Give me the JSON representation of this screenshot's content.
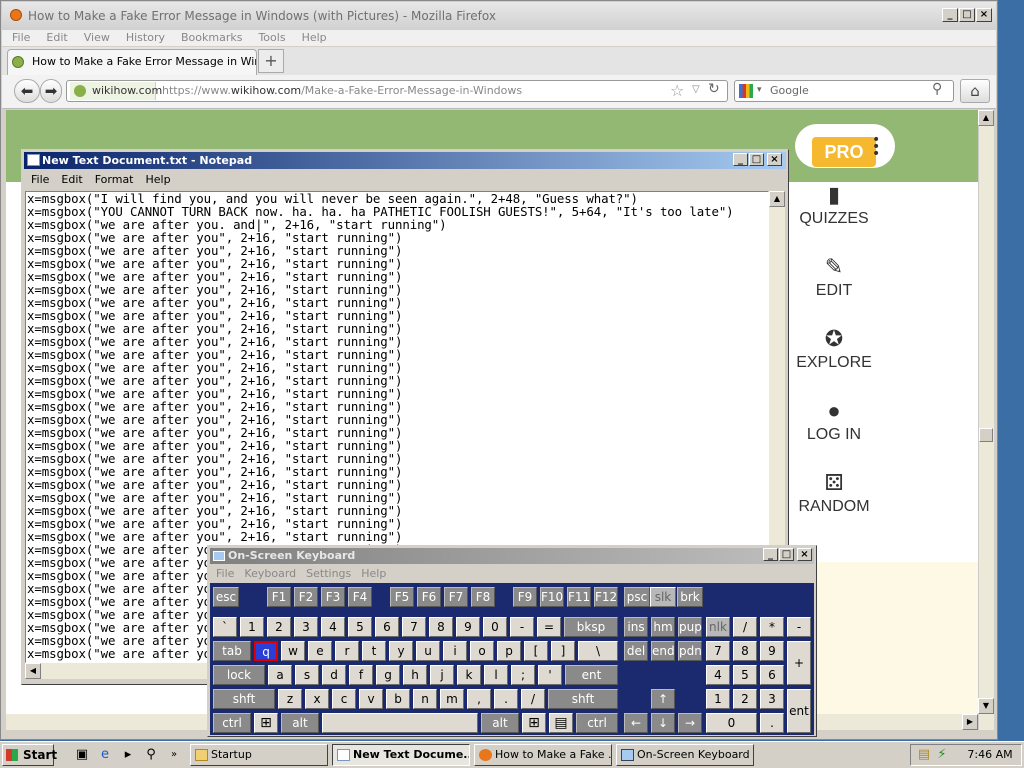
{
  "firefox": {
    "title": "How to Make a Fake Error Message in Windows (with Pictures) - Mozilla Firefox",
    "menu": [
      "File",
      "Edit",
      "View",
      "History",
      "Bookmarks",
      "Tools",
      "Help"
    ],
    "tab_label": "How to Make a Fake Error Message in Windo...",
    "new_tab": "+",
    "identity": "wikihow.com",
    "url_prefix": "https://www.",
    "url_host": "wikihow.com",
    "url_path": "/Make-a-Fake-Error-Message-in-Windows",
    "search_placeholder": "Google"
  },
  "page": {
    "pro_label": "PRO",
    "sidebar": [
      {
        "label": "QUIZZES",
        "icon": "quizzes-icon"
      },
      {
        "label": "EDIT",
        "icon": "pencil-icon"
      },
      {
        "label": "EXPLORE",
        "icon": "compass-icon"
      },
      {
        "label": "LOG IN",
        "icon": "user-icon"
      },
      {
        "label": "RANDOM",
        "icon": "dice-icon"
      }
    ]
  },
  "notepad": {
    "title": "New Text Document.txt - Notepad",
    "menu": [
      "File",
      "Edit",
      "Format",
      "Help"
    ],
    "lines": [
      "x=msgbox(\"I will find you, and you will never be seen again.\", 2+48, \"Guess what?\")",
      "x=msgbox(\"YOU CANNOT TURN BACK now. ha. ha. ha PATHETIC FOOLISH GUESTS!\", 5+64, \"It's too late\")",
      "x=msgbox(\"we are after you. and|\", 2+16, \"start running\")",
      "x=msgbox(\"we are after you\", 2+16, \"start running\")",
      "x=msgbox(\"we are after you\", 2+16, \"start running\")",
      "x=msgbox(\"we are after you\", 2+16, \"start running\")",
      "x=msgbox(\"we are after you\", 2+16, \"start running\")",
      "x=msgbox(\"we are after you\", 2+16, \"start running\")",
      "x=msgbox(\"we are after you\", 2+16, \"start running\")",
      "x=msgbox(\"we are after you\", 2+16, \"start running\")",
      "x=msgbox(\"we are after you\", 2+16, \"start running\")",
      "x=msgbox(\"we are after you\", 2+16, \"start running\")",
      "x=msgbox(\"we are after you\", 2+16, \"start running\")",
      "x=msgbox(\"we are after you\", 2+16, \"start running\")",
      "x=msgbox(\"we are after you\", 2+16, \"start running\")",
      "x=msgbox(\"we are after you\", 2+16, \"start running\")",
      "x=msgbox(\"we are after you\", 2+16, \"start running\")",
      "x=msgbox(\"we are after you\", 2+16, \"start running\")",
      "x=msgbox(\"we are after you\", 2+16, \"start running\")",
      "x=msgbox(\"we are after you\", 2+16, \"start running\")",
      "x=msgbox(\"we are after you\", 2+16, \"start running\")",
      "x=msgbox(\"we are after you\", 2+16, \"start running\")",
      "x=msgbox(\"we are after you\", 2+16, \"start running\")",
      "x=msgbox(\"we are after you\", 2+16, \"start running\")",
      "x=msgbox(\"we are after you\", 2+16, \"start running\")",
      "x=msgbox(\"we are after you\", 2+16, \"start running\")",
      "x=msgbox(\"we are after you\", 2+16, \"start running\")",
      "x=msgbox(\"we are after you\", 2+16, \"start running\")",
      "x=msgbox(\"we are after you\", 2+16, \"start running\")",
      "x=msgbox(\"we are after you\", 2+16, \"start running\")",
      "x=msgbox(\"we are after you\", 2+16, \"start running\")",
      "x=msgbox(\"we are after you\", 2+16, \"start running\")",
      "x=msgbox(\"we are after you\", 2+16, \"start running\")",
      "x=msgbox(\"we are after you\", 2+16, \"start running\")",
      "x=msgbox(\"we are after you\", 2+16, \"start running\")",
      "x=msgbox(\"we are after you\", 2+16, \"start running\")"
    ]
  },
  "osk": {
    "title": "On-Screen Keyboard",
    "menu": [
      "File",
      "Keyboard",
      "Settings",
      "Help"
    ],
    "selected_key": "q"
  },
  "taskbar": {
    "start": "Start",
    "tasks": [
      {
        "label": "Startup",
        "icon": "folder-icon",
        "active": false
      },
      {
        "label": "New Text Docume...",
        "icon": "notepad-icon",
        "active": true
      },
      {
        "label": "How to Make a Fake ...",
        "icon": "firefox-icon",
        "active": false
      },
      {
        "label": "On-Screen Keyboard",
        "icon": "keyboard-icon",
        "active": false
      }
    ],
    "clock": "7:46 AM"
  },
  "colors": {
    "wikihow_green": "#93b874",
    "pro_orange": "#f5b82e",
    "osk_background": "#1b2a6e",
    "notepad_title": "#0a246a"
  }
}
